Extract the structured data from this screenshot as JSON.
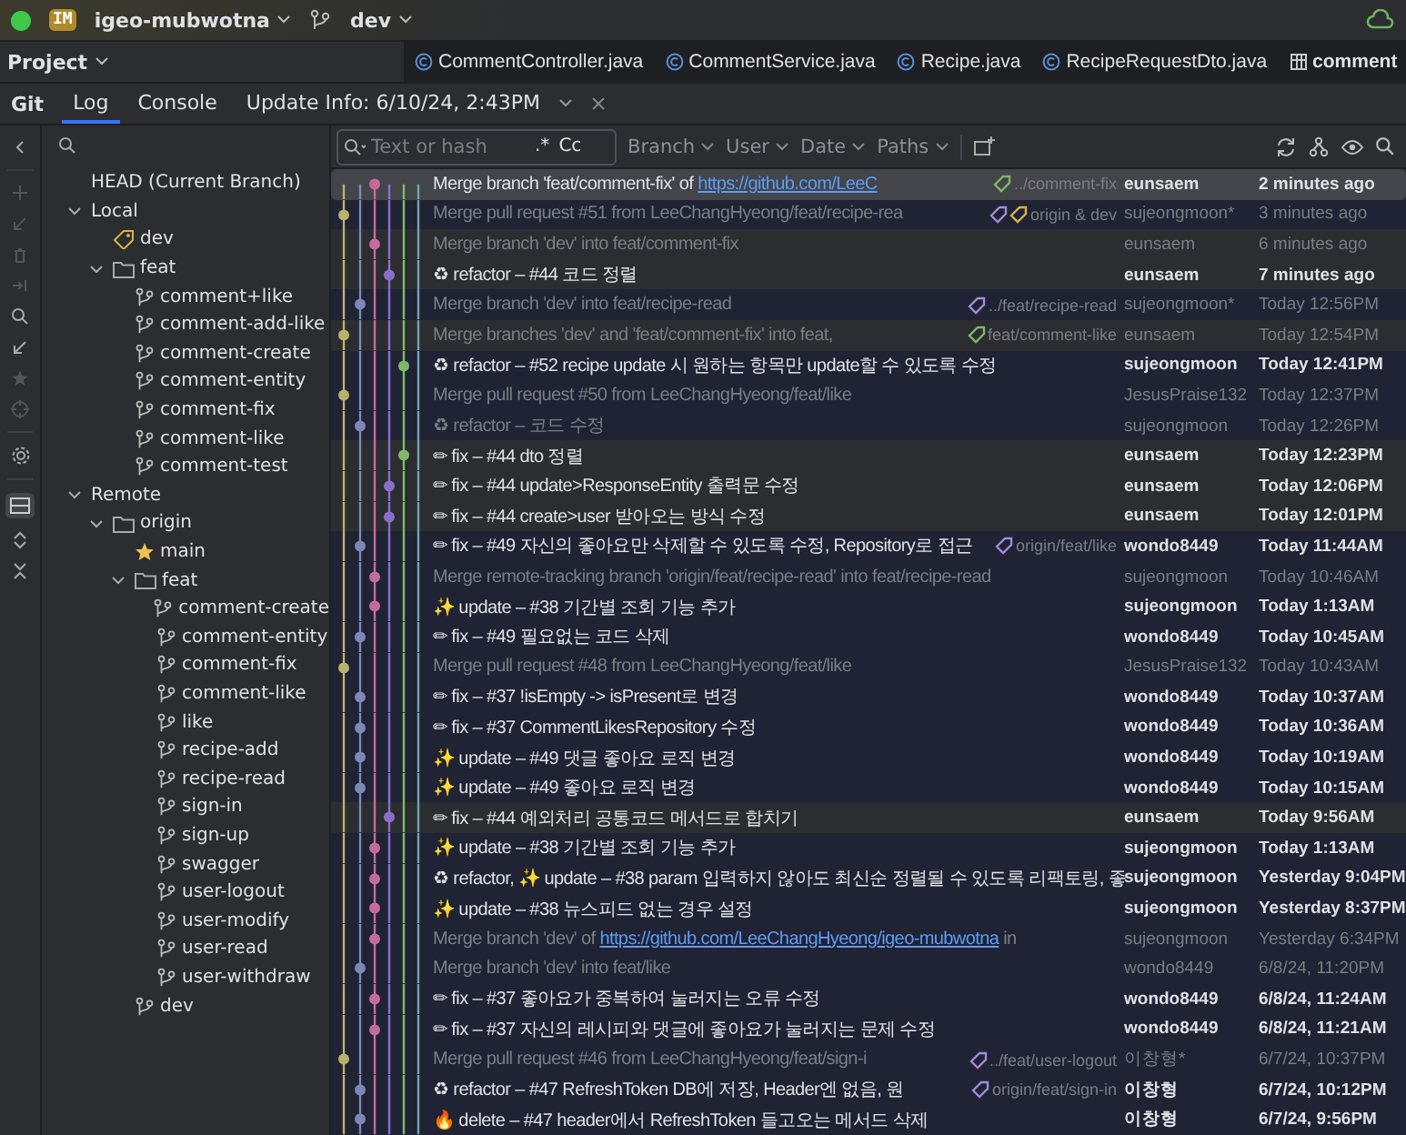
{
  "title_bar": {
    "project_badge": "IM",
    "project": "igeo-mubwotna",
    "branch": "dev"
  },
  "project_panel": {
    "title": "Project"
  },
  "editor_tabs": [
    {
      "label": "CommentController.java",
      "kind": "class"
    },
    {
      "label": "CommentService.java",
      "kind": "class"
    },
    {
      "label": "Recipe.java",
      "kind": "class"
    },
    {
      "label": "RecipeRequestDto.java",
      "kind": "class"
    },
    {
      "label": "comment",
      "kind": "table"
    }
  ],
  "git": {
    "title": "Git",
    "tabs": [
      {
        "label": "Log",
        "selected": true
      },
      {
        "label": "Console",
        "selected": false
      },
      {
        "label": "Update Info: 6/10/24, 2:43PM",
        "selected": false
      }
    ]
  },
  "filter_bar": {
    "placeholder": "Text or hash",
    "regex": ".*",
    "case": "Cc",
    "filters": [
      "Branch",
      "User",
      "Date",
      "Paths"
    ]
  },
  "branches": [
    {
      "label": "HEAD (Current Branch)"
    },
    {
      "label": "Local",
      "expanded": true,
      "children": [
        {
          "label": "dev",
          "kind": "current"
        },
        {
          "label": "feat",
          "kind": "folder",
          "expanded": true,
          "children": [
            {
              "label": "comment+like",
              "kind": "branch"
            },
            {
              "label": "comment-add-like",
              "kind": "branch"
            },
            {
              "label": "comment-create",
              "kind": "branch"
            },
            {
              "label": "comment-entity",
              "kind": "branch"
            },
            {
              "label": "comment-fix",
              "kind": "branch"
            },
            {
              "label": "comment-like",
              "kind": "branch"
            },
            {
              "label": "comment-test",
              "kind": "branch"
            }
          ]
        }
      ]
    },
    {
      "label": "Remote",
      "expanded": true,
      "children": [
        {
          "label": "origin",
          "kind": "folder",
          "expanded": true,
          "children": [
            {
              "label": "main",
              "kind": "favorite"
            },
            {
              "label": "feat",
              "kind": "folder",
              "expanded": true,
              "children": [
                {
                  "label": "comment-create",
                  "kind": "branch"
                },
                {
                  "label": "comment-entity",
                  "kind": "branch"
                },
                {
                  "label": "comment-fix",
                  "kind": "branch"
                },
                {
                  "label": "comment-like",
                  "kind": "branch"
                },
                {
                  "label": "like",
                  "kind": "branch"
                },
                {
                  "label": "recipe-add",
                  "kind": "branch"
                },
                {
                  "label": "recipe-read",
                  "kind": "branch"
                },
                {
                  "label": "sign-in",
                  "kind": "branch"
                },
                {
                  "label": "sign-up",
                  "kind": "branch"
                },
                {
                  "label": "swagger",
                  "kind": "branch"
                },
                {
                  "label": "user-logout",
                  "kind": "branch"
                },
                {
                  "label": "user-modify",
                  "kind": "branch"
                },
                {
                  "label": "user-read",
                  "kind": "branch"
                },
                {
                  "label": "user-withdraw",
                  "kind": "branch"
                }
              ]
            },
            {
              "label": "dev",
              "kind": "branch"
            }
          ]
        }
      ]
    }
  ],
  "commits": [
    {
      "message": "Merge branch 'feat/comment-fix' of ",
      "link": "https://github.com/LeeC",
      "refs": {
        "label": "../comment-fix",
        "tags": [
          {
            "color": "#7fb86a"
          }
        ]
      },
      "author": "eunsaem",
      "date": "2 minutes ago",
      "dimmed": false,
      "selected": true
    },
    {
      "message": "Merge pull request #51 from LeeChangHyeong/feat/recipe-rea",
      "refs": {
        "label": "origin & dev",
        "tags": [
          {
            "color": "#a48ad8"
          },
          {
            "color": "#d7b34a"
          }
        ]
      },
      "author": "sujeongmoon*",
      "date": "3 minutes ago",
      "dimmed": true,
      "selected": false,
      "highlighted": true
    },
    {
      "message": "Merge branch 'dev' into feat/comment-fix",
      "author": "eunsaem",
      "date": "6 minutes ago",
      "dimmed": true,
      "selected": false,
      "highlighted": false
    },
    {
      "message": "♻ refactor – #44 코드 정렬",
      "author": "eunsaem",
      "date": "7 minutes ago",
      "dimmed": false,
      "selected": false,
      "highlighted": false
    },
    {
      "message": "Merge branch 'dev' into feat/recipe-read",
      "refs": {
        "label": "../feat/recipe-read",
        "tags": [
          {
            "color": "#a48ad8"
          }
        ]
      },
      "author": "sujeongmoon*",
      "date": "Today 12:56PM",
      "dimmed": true,
      "selected": false,
      "highlighted": true
    },
    {
      "message": "Merge branches 'dev' and 'feat/comment-fix' into feat,",
      "refs": {
        "label": "feat/comment-like",
        "tags": [
          {
            "color": "#7fb86a"
          }
        ]
      },
      "author": "eunsaem",
      "date": "Today 12:54PM",
      "dimmed": true,
      "selected": false,
      "highlighted": false
    },
    {
      "message": "♻ refactor – #52 recipe update 시 원하는 항목만 update할 수 있도록 수정",
      "author": "sujeongmoon",
      "date": "Today 12:41PM",
      "dimmed": false,
      "selected": false,
      "highlighted": true
    },
    {
      "message": "Merge pull request #50 from LeeChangHyeong/feat/like",
      "author": "JesusPraise132",
      "date": "Today 12:37PM",
      "dimmed": true,
      "selected": false,
      "highlighted": true
    },
    {
      "message": "♻ refactor – 코드 수정",
      "author": "sujeongmoon",
      "date": "Today 12:26PM",
      "dimmed": true,
      "selected": false,
      "highlighted": true
    },
    {
      "message": "✏ fix – #44 dto 정렬",
      "author": "eunsaem",
      "date": "Today 12:23PM",
      "dimmed": false,
      "selected": false,
      "highlighted": false
    },
    {
      "message": "✏ fix – #44 update>ResponseEntity 출력문 수정",
      "author": "eunsaem",
      "date": "Today 12:06PM",
      "dimmed": false,
      "selected": false,
      "highlighted": false
    },
    {
      "message": "✏ fix – #44 create>user 받아오는 방식 수정",
      "author": "eunsaem",
      "date": "Today 12:01PM",
      "dimmed": false,
      "selected": false,
      "highlighted": false
    },
    {
      "message": "✏ fix – #49 자신의 좋아요만 삭제할 수 있도록 수정, Repository로 접근",
      "refs": {
        "label": "origin/feat/like",
        "tags": [
          {
            "color": "#a48ad8"
          }
        ]
      },
      "author": "wondo8449",
      "date": "Today 11:44AM",
      "dimmed": false,
      "selected": false,
      "highlighted": true
    },
    {
      "message": "Merge remote-tracking branch 'origin/feat/recipe-read' into feat/recipe-read",
      "author": "sujeongmoon",
      "date": "Today 10:46AM",
      "dimmed": true,
      "selected": false,
      "highlighted": true
    },
    {
      "message": "✨ update – #38 기간별 조회 기능 추가",
      "author": "sujeongmoon",
      "date": "Today 1:13AM",
      "dimmed": false,
      "selected": false,
      "highlighted": true
    },
    {
      "message": "✏ fix – #49 필요없는 코드 삭제",
      "author": "wondo8449",
      "date": "Today 10:45AM",
      "dimmed": false,
      "selected": false,
      "highlighted": true
    },
    {
      "message": "Merge pull request #48 from LeeChangHyeong/feat/like",
      "author": "JesusPraise132",
      "date": "Today 10:43AM",
      "dimmed": true,
      "selected": false,
      "highlighted": true
    },
    {
      "message": "✏ fix – #37 !isEmpty -> isPresent로 변경",
      "author": "wondo8449",
      "date": "Today 10:37AM",
      "dimmed": false,
      "selected": false,
      "highlighted": true
    },
    {
      "message": "✏ fix – #37 CommentLikesRepository 수정",
      "author": "wondo8449",
      "date": "Today 10:36AM",
      "dimmed": false,
      "selected": false,
      "highlighted": true
    },
    {
      "message": "✨ update – #49 댓글 좋아요 로직 변경",
      "author": "wondo8449",
      "date": "Today 10:19AM",
      "dimmed": false,
      "selected": false,
      "highlighted": true
    },
    {
      "message": "✨ update – #49 좋아요 로직 변경",
      "author": "wondo8449",
      "date": "Today 10:15AM",
      "dimmed": false,
      "selected": false,
      "highlighted": true
    },
    {
      "message": "✏ fix – #44 예외처리 공통코드 메서드로 합치기",
      "author": "eunsaem",
      "date": "Today 9:56AM",
      "dimmed": false,
      "selected": false,
      "highlighted": false
    },
    {
      "message": "✨ update – #38 기간별 조회 기능 추가",
      "author": "sujeongmoon",
      "date": "Today 1:13AM",
      "dimmed": false,
      "selected": false,
      "highlighted": true
    },
    {
      "message": "♻ refactor, ✨ update – #38 param 입력하지 않아도 최신순 정렬될 수 있도록 리팩토링, 좋",
      "author": "sujeongmoon",
      "date": "Yesterday 9:04PM",
      "dimmed": false,
      "selected": false,
      "highlighted": true
    },
    {
      "message": "✨ update – #38 뉴스피드 없는 경우 설정",
      "author": "sujeongmoon",
      "date": "Yesterday 8:37PM",
      "dimmed": false,
      "selected": false,
      "highlighted": true
    },
    {
      "message": "Merge branch 'dev' of ",
      "link": "https://github.com/LeeChangHyeong/igeo-mubwotna",
      "message_end": " in",
      "author": "sujeongmoon",
      "date": "Yesterday 6:34PM",
      "dimmed": true,
      "selected": false,
      "highlighted": true
    },
    {
      "message": "Merge branch 'dev' into feat/like",
      "author": "wondo8449",
      "date": "6/8/24, 11:20PM",
      "dimmed": true,
      "selected": false,
      "highlighted": true
    },
    {
      "message": "✏ fix – #37 좋아요가 중복하여 눌러지는 오류 수정",
      "author": "wondo8449",
      "date": "6/8/24, 11:24AM",
      "dimmed": false,
      "selected": false,
      "highlighted": true
    },
    {
      "message": "✏ fix – #37 자신의 레시피와 댓글에 좋아요가 눌러지는 문제 수정",
      "author": "wondo8449",
      "date": "6/8/24, 11:21AM",
      "dimmed": false,
      "selected": false,
      "highlighted": true
    },
    {
      "message": "Merge pull request #46 from LeeChangHyeong/feat/sign-i",
      "refs": {
        "label": "../feat/user-logout",
        "tags": [
          {
            "color": "#a48ad8"
          }
        ]
      },
      "author": "이창형*",
      "date": "6/7/24, 10:37PM",
      "dimmed": true,
      "selected": false,
      "highlighted": true
    },
    {
      "message": "♻ refactor – #47 RefreshToken DB에 저장, Header엔 없음, 원",
      "refs": {
        "label": "origin/feat/sign-in",
        "tags": [
          {
            "color": "#a48ad8"
          }
        ]
      },
      "author": "이창형",
      "date": "6/7/24, 10:12PM",
      "dimmed": false,
      "selected": false,
      "highlighted": true
    },
    {
      "message": "🔥 delete – #47 header에서 RefreshToken 들고오는 메서드 삭제",
      "author": "이창형",
      "date": "6/7/24, 9:56PM",
      "dimmed": false,
      "selected": false,
      "highlighted": true
    }
  ]
}
